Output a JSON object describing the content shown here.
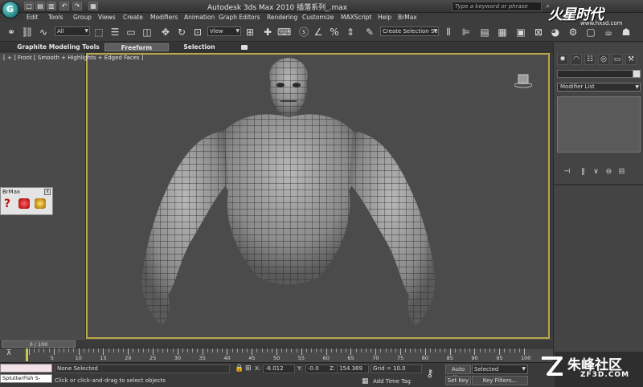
{
  "window": {
    "title": "Autodesk 3ds Max  2010     插落系列_.max",
    "search_placeholder": "Type a keyword or phrase",
    "app_logo_letter": "G"
  },
  "quick_access": [
    "□",
    "▤",
    "▥",
    "↶",
    "↷",
    "▦"
  ],
  "menu": [
    "Edit",
    "Tools",
    "Group",
    "Views",
    "Create",
    "Modifiers",
    "Animation",
    "Graph Editors",
    "Rendering",
    "Customize",
    "MAXScript",
    "Help",
    "BrMax"
  ],
  "watermark_top": {
    "logo": "火星时代",
    "url": "www.hxsd.com"
  },
  "toolbar": {
    "selection_filter": "All",
    "ref_coord": "View",
    "named_selection": "Create Selection Se"
  },
  "ribbon": {
    "tabs": [
      "Graphite Modeling Tools",
      "Freeform",
      "Selection"
    ]
  },
  "viewport": {
    "label": "[ + ] Front [ Smooth + Highlights + Edged Faces ]"
  },
  "brmax": {
    "title": "BrMax",
    "close": "x"
  },
  "command_panel": {
    "modifier_list": "Modifier List"
  },
  "timeline": {
    "slider": "0 / 100",
    "ticks": [
      "5",
      "10",
      "15",
      "20",
      "25",
      "30",
      "35",
      "40",
      "45",
      "50",
      "55",
      "60",
      "65",
      "70",
      "75",
      "80",
      "85",
      "90",
      "95",
      "100"
    ]
  },
  "status": {
    "maxscript": "SplutterFish S-",
    "selection": "None Selected",
    "prompt": "Click or click-and-drag to select objects",
    "x_label": "X:",
    "x_value": "-8.012",
    "y_label": "Y:",
    "y_value": "-0.0",
    "z_label": "Z:",
    "z_value": "154.369",
    "grid": "Grid = 10.0",
    "add_time_tag": "Add Time Tag",
    "auto_key": "Auto Key",
    "set_key": "Set Key",
    "selected": "Selected",
    "key_filters": "Key Filters..."
  },
  "watermark_bottom": {
    "text": "朱峰社区",
    "url": "ZF3D.COM"
  }
}
